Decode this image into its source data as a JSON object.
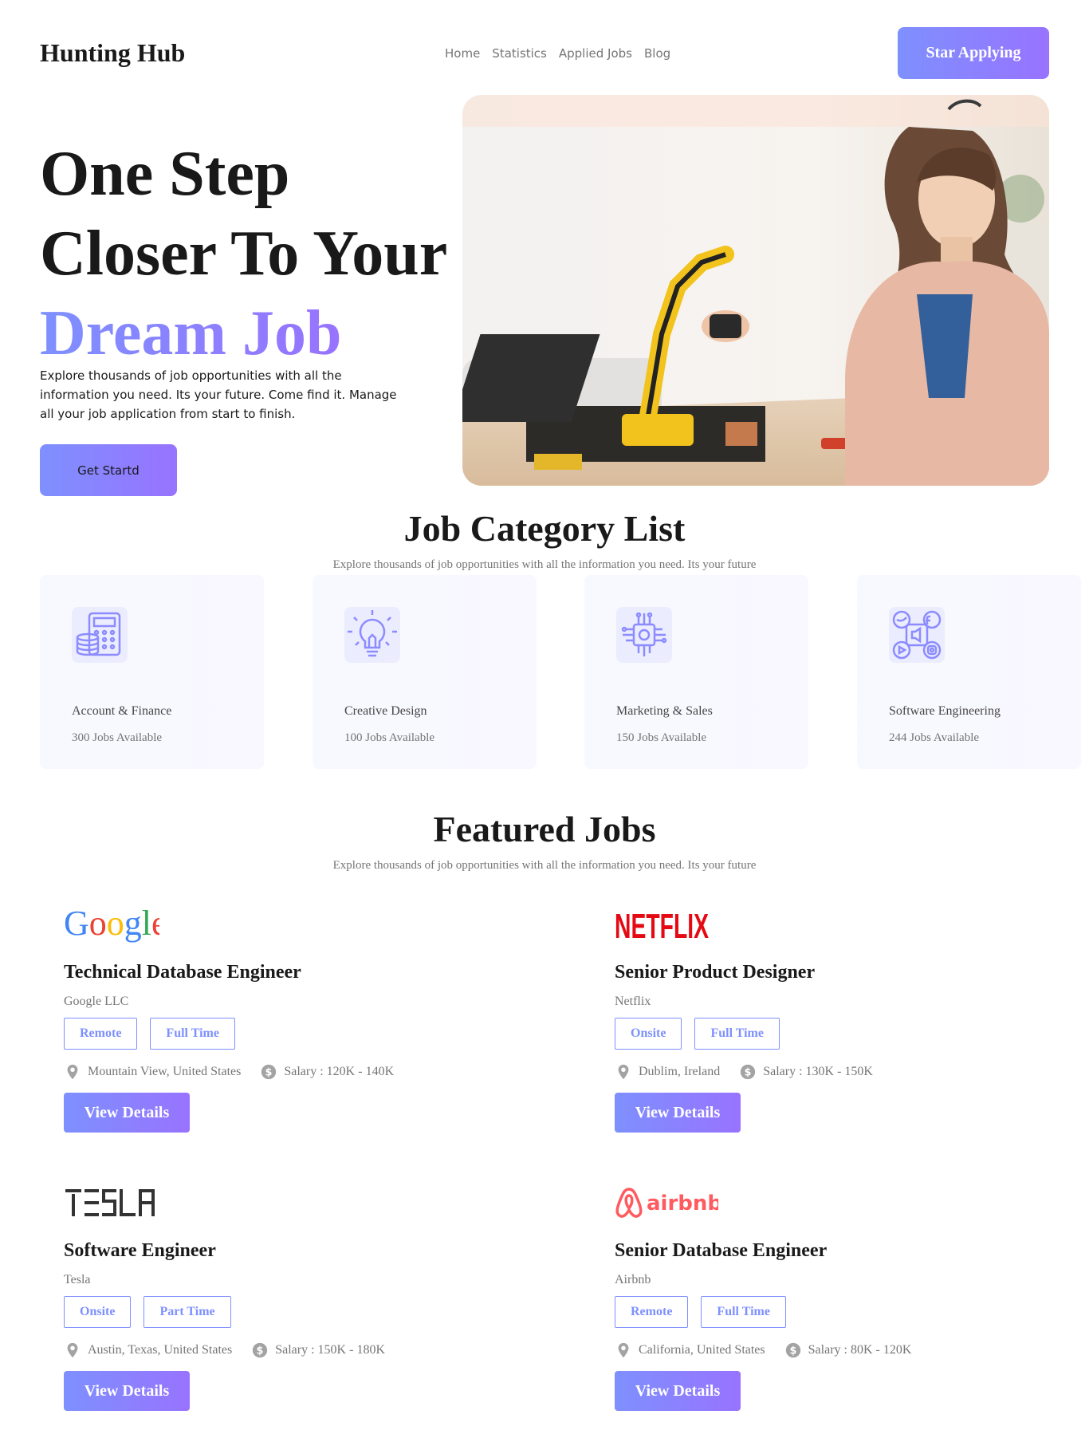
{
  "nav": {
    "brand": "Hunting Hub",
    "links": [
      "Home",
      "Statistics",
      "Applied Jobs",
      "Blog"
    ],
    "cta": "Star Applying"
  },
  "hero": {
    "title_line1": "One Step",
    "title_line2": "Closer To Your",
    "title_accent": "Dream Job",
    "description": "Explore thousands of job opportunities with all the information you need. Its your future. Come find it. Manage all your job application from start to finish.",
    "button": "Get Startd"
  },
  "categories": {
    "title": "Job Category List",
    "subtitle": "Explore thousands of job opportunities with all the information you need. Its your future",
    "items": [
      {
        "name": "Account & Finance",
        "count": "300 Jobs Available",
        "icon": "calculator-coins-icon"
      },
      {
        "name": "Creative Design",
        "count": "100 Jobs Available",
        "icon": "lightbulb-icon"
      },
      {
        "name": "Marketing & Sales",
        "count": "150 Jobs Available",
        "icon": "circuit-chip-icon"
      },
      {
        "name": "Software Engineering",
        "count": "244 Jobs Available",
        "icon": "social-media-icon"
      }
    ]
  },
  "featured": {
    "title": "Featured Jobs",
    "subtitle": "Explore thousands of job opportunities with all the information you need. Its your future",
    "jobs": [
      {
        "logo": "Google",
        "title": "Technical Database Engineer",
        "company": "Google LLC",
        "tags": [
          "Remote",
          "Full Time"
        ],
        "location": "Mountain View, United States",
        "salary": "Salary : 120K - 140K",
        "button": "View Details"
      },
      {
        "logo": "NETFLIX",
        "title": "Senior Product Designer",
        "company": "Netflix",
        "tags": [
          "Onsite",
          "Full Time"
        ],
        "location": "Dublim, Ireland",
        "salary": "Salary : 130K - 150K",
        "button": "View Details"
      },
      {
        "logo": "TESLA",
        "title": "Software Engineer",
        "company": "Tesla",
        "tags": [
          "Onsite",
          "Part Time"
        ],
        "location": "Austin, Texas, United States",
        "salary": "Salary : 150K - 180K",
        "button": "View Details"
      },
      {
        "logo": "airbnb",
        "title": "Senior Database Engineer",
        "company": "Airbnb",
        "tags": [
          "Remote",
          "Full Time"
        ],
        "location": "California, United States",
        "salary": "Salary : 80K - 120K",
        "button": "View Details"
      }
    ]
  },
  "colors": {
    "accent_start": "#7e90fe",
    "accent_end": "#9873ff",
    "netflix_red": "#e50914",
    "airbnb_red": "#ff5a5f"
  }
}
